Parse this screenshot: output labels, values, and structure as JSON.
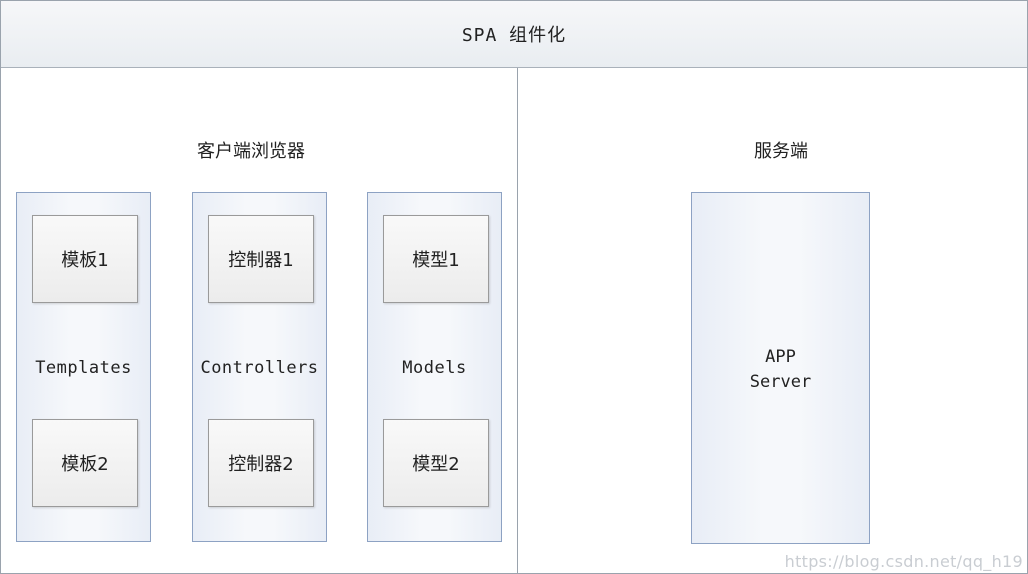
{
  "title": "SPA 组件化",
  "client": {
    "label": "客户端浏览器",
    "columns": [
      {
        "name": "Templates",
        "items": [
          "模板1",
          "模板2"
        ]
      },
      {
        "name": "Controllers",
        "items": [
          "控制器1",
          "控制器2"
        ]
      },
      {
        "name": "Models",
        "items": [
          "模型1",
          "模型2"
        ]
      }
    ]
  },
  "server": {
    "label": "服务端",
    "box_line1": "APP",
    "box_line2": "Server"
  },
  "watermark": "https://blog.csdn.net/qq_h19"
}
